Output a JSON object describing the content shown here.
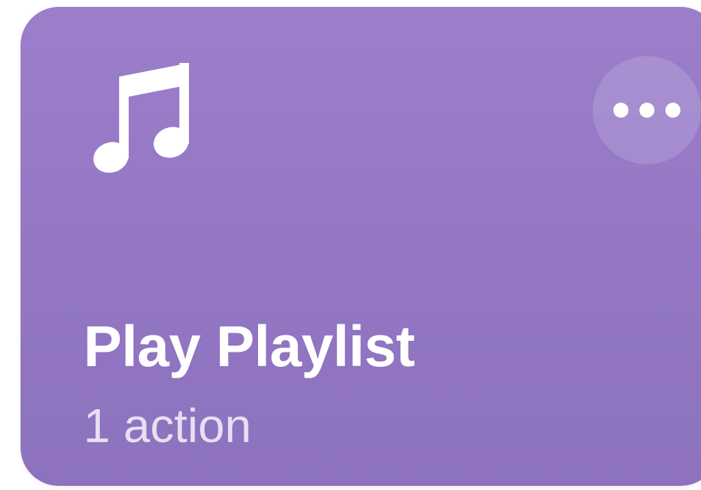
{
  "card": {
    "title": "Play Playlist",
    "subtitle": "1 action",
    "icon": "music-note-icon",
    "more_icon": "ellipsis-icon",
    "colors": {
      "background_top": "#9b7fcb",
      "background_bottom": "#8d72be",
      "text": "#ffffff",
      "more_button_fill": "rgba(255,255,255,0.14)"
    }
  }
}
